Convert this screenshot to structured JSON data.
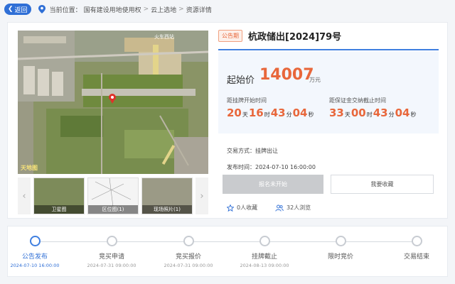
{
  "nav": {
    "back_label": "返回",
    "location_prefix": "当前位置：",
    "crumbs": [
      "国有建设用地使用权",
      "云上选地",
      "资源详情"
    ]
  },
  "gallery": {
    "map_label": "火车西站",
    "watermark": "天地图",
    "thumbs": [
      "卫星图",
      "区位图(1)",
      "现场照片(1)"
    ]
  },
  "listing": {
    "badge": "公告期",
    "title": "杭政储出[2024]79号",
    "price_label": "起始价",
    "price": "14007",
    "price_unit": "万元",
    "countdown_start": {
      "label": "距挂牌开始时间",
      "days": "20",
      "hours": "16",
      "minutes": "43",
      "seconds": "04"
    },
    "countdown_deposit": {
      "label": "距保证金交纳截止时间",
      "days": "33",
      "hours": "00",
      "minutes": "43",
      "seconds": "04"
    },
    "unit_day": "天",
    "unit_hour": "时",
    "unit_min": "分",
    "unit_sec": "秒",
    "trade_method_label": "交易方式：",
    "trade_method": "挂牌出让",
    "publish_label": "发布时间：",
    "publish_time": "2024-07-10 16:00:00",
    "signup_button": "报名未开始",
    "fav_button": "我要收藏",
    "fav_count": "0人收藏",
    "view_count": "32人浏览"
  },
  "timeline": [
    {
      "label": "公告发布",
      "date": "2024-07-10 16:00:00",
      "active": true
    },
    {
      "label": "竞买申请",
      "date": "2024-07-31 09:00:00",
      "active": false
    },
    {
      "label": "竞买报价",
      "date": "2024-07-31 09:00:00",
      "active": false
    },
    {
      "label": "挂牌截止",
      "date": "2024-08-13 09:00:00",
      "active": false
    },
    {
      "label": "限时竞价",
      "date": "",
      "active": false
    },
    {
      "label": "交易结束",
      "date": "",
      "active": false
    }
  ],
  "colors": {
    "accent": "#2f6fd6",
    "price": "#e8673b",
    "disabled": "#c9cbce"
  }
}
